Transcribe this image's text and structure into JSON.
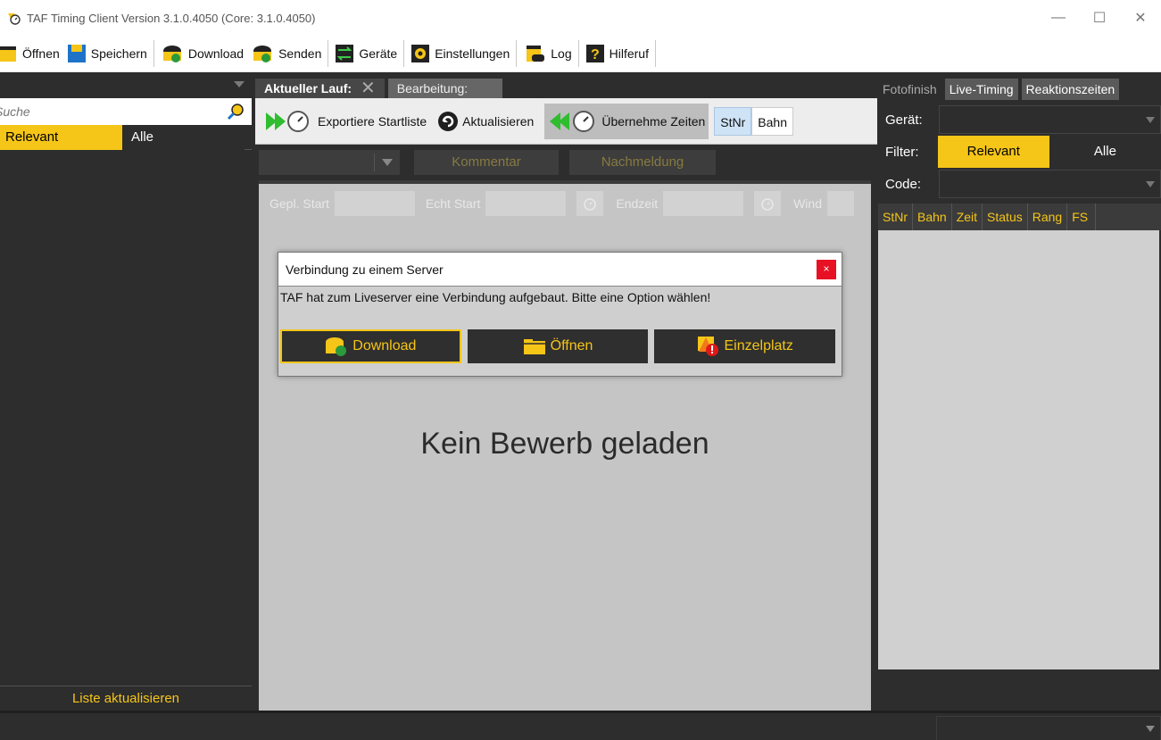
{
  "window": {
    "title": "TAF Timing Client Version 3.1.0.4050 (Core: 3.1.0.4050)",
    "controls": [
      "—",
      "☐",
      "✕"
    ]
  },
  "toolbar": {
    "items": [
      {
        "label": "Öffnen",
        "icon": "folder-icon"
      },
      {
        "label": "Speichern",
        "icon": "save-icon"
      },
      {
        "label": "Download",
        "icon": "download-icon"
      },
      {
        "label": "Senden",
        "icon": "upload-icon"
      },
      {
        "label": "Geräte",
        "icon": "devices-icon"
      },
      {
        "label": "Einstellungen",
        "icon": "settings-icon"
      },
      {
        "label": "Log",
        "icon": "log-icon"
      },
      {
        "label": "Hilferuf",
        "icon": "help-icon"
      }
    ]
  },
  "left_panel": {
    "search_placeholder": "Suche",
    "filter_relevant": "Relevant",
    "filter_all": "Alle",
    "refresh_label": "Liste aktualisieren"
  },
  "center": {
    "tab_current": "Aktueller Lauf:",
    "tab_edit": "Bearbeitung:",
    "export_label": "Exportiere Startliste",
    "refresh_label": "Aktualisieren",
    "take_times_label": "Übernehme Zeiten",
    "toggle_stnr": "StNr",
    "toggle_bahn": "Bahn",
    "comment_label": "Kommentar",
    "late_label": "Nachmeldung",
    "planned_start": "Gepl. Start",
    "real_start": "Echt Start",
    "end_time": "Endzeit",
    "wind": "Wind",
    "empty_message": "Kein Bewerb geladen"
  },
  "dialog": {
    "title": "Verbindung zu einem Server",
    "close": "×",
    "message": "TAF hat zum Liveserver eine Verbindung aufgebaut. Bitte eine Option wählen!",
    "buttons": [
      "Download",
      "Öffnen",
      "Einzelplatz"
    ]
  },
  "right_panel": {
    "tabs": [
      "Fotofinish",
      "Live-Timing",
      "Reaktionszeiten"
    ],
    "device_label": "Gerät:",
    "filter_label": "Filter:",
    "filter_relevant": "Relevant",
    "filter_all": "Alle",
    "code_label": "Code:",
    "columns": [
      "StNr",
      "Bahn",
      "Zeit",
      "Status",
      "Rang",
      "FS"
    ]
  },
  "colors": {
    "accent": "#f5c518",
    "dark_bg": "#2d2d2d",
    "panel_grey": "#c5c5c5",
    "close_red": "#e81123"
  }
}
